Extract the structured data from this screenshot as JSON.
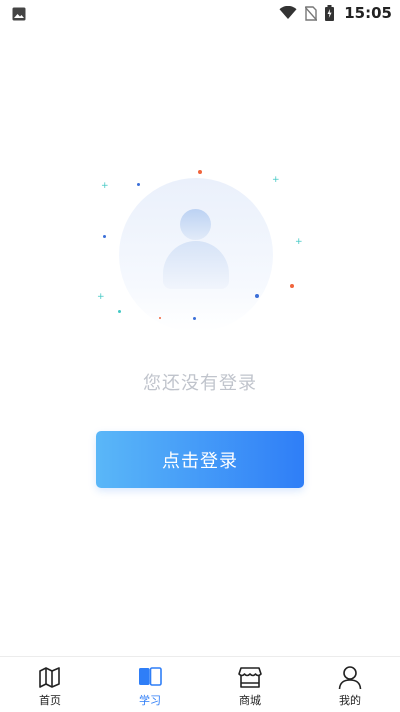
{
  "status_bar": {
    "time": "15:05",
    "icons": [
      "image-icon",
      "wifi-icon",
      "no-sim-icon",
      "battery-charging-icon"
    ]
  },
  "empty_state": {
    "message": "您还没有登录"
  },
  "login_button": {
    "label": "点击登录"
  },
  "tab_bar": {
    "items": [
      {
        "label": "首页",
        "icon": "map-book-icon",
        "active": false
      },
      {
        "label": "学习",
        "icon": "open-book-icon",
        "active": true
      },
      {
        "label": "商城",
        "icon": "store-icon",
        "active": false
      },
      {
        "label": "我的",
        "icon": "user-icon",
        "active": false
      }
    ]
  },
  "colors": {
    "accent": "#2f7ef7",
    "accent_light": "#5ab7f8",
    "empty_text": "#c0c4cc",
    "inactive_icon": "#222222"
  }
}
